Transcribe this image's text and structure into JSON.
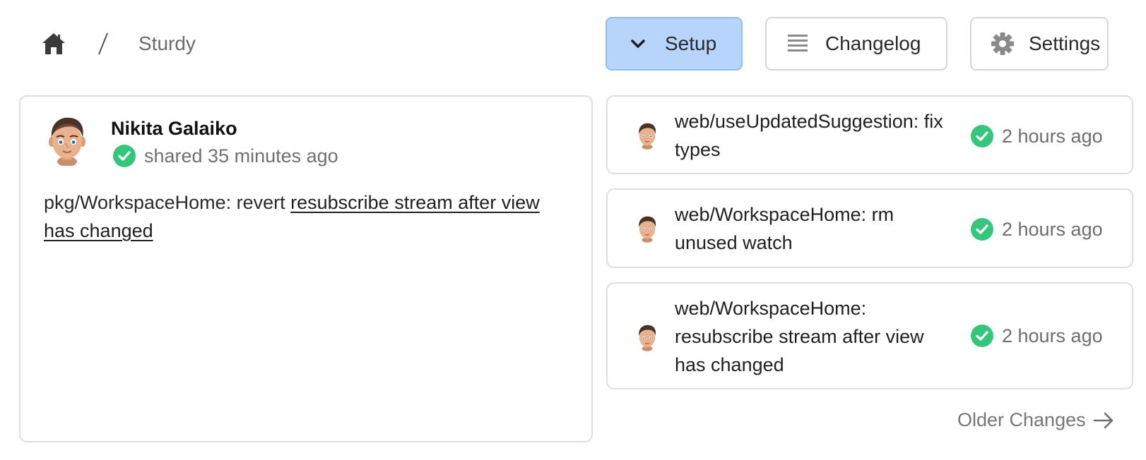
{
  "breadcrumb": {
    "home_icon": "home-icon",
    "separator": "/",
    "current": "Sturdy"
  },
  "toolbar": {
    "setup": {
      "label": "Setup",
      "icon": "chevron-down-icon",
      "bg": "#b7d5fb"
    },
    "changelog": {
      "label": "Changelog",
      "icon": "list-icon"
    },
    "settings": {
      "label": "Settings",
      "icon": "gear-icon"
    }
  },
  "main_change": {
    "author": "Nikita Galaiko",
    "status_icon": "check-circle-icon",
    "shared": "shared 35 minutes ago",
    "message_prefix": "pkg/WorkspaceHome: revert ",
    "message_link": "resubscribe stream after view has changed"
  },
  "changes": [
    {
      "message": "web/useUpdatedSuggestion: fix types",
      "time": "2 hours ago"
    },
    {
      "message": "web/WorkspaceHome: rm unused watch",
      "time": "2 hours ago"
    },
    {
      "message": "web/WorkspaceHome: resubscribe stream after view has changed",
      "time": "2 hours ago"
    }
  ],
  "older_changes": {
    "label": "Older Changes",
    "icon": "arrow-right-icon"
  },
  "colors": {
    "success": "#34c77b",
    "accent": "#b7d5fb"
  }
}
